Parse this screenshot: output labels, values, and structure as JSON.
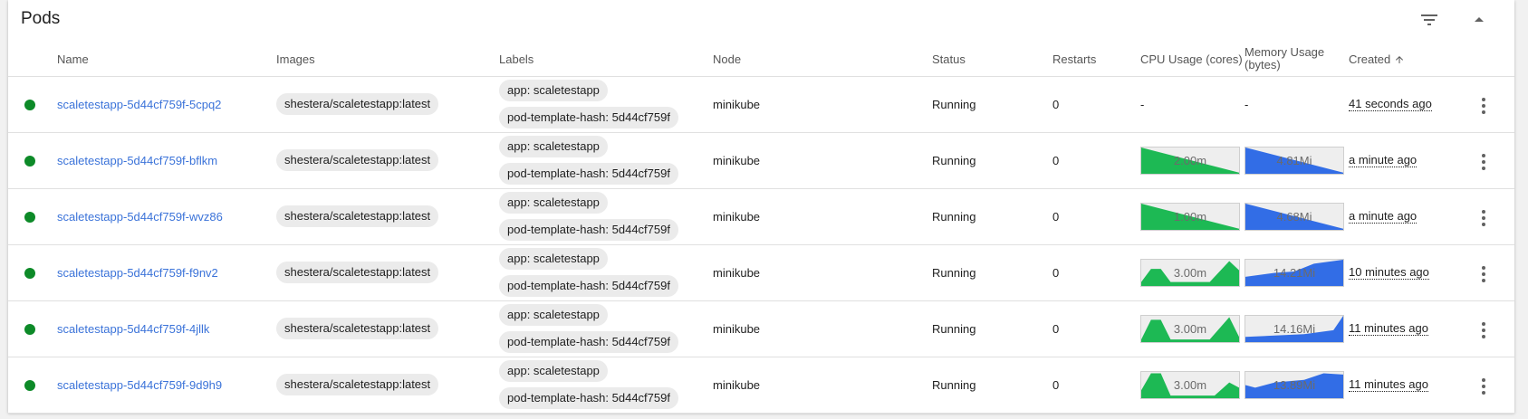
{
  "card": {
    "title": "Pods"
  },
  "icons": {
    "filter": "filter-list-icon",
    "collapse": "expand-less-icon",
    "row_menu": "more-vert-icon",
    "sort": "arrow-upward-icon"
  },
  "columns": {
    "name": "Name",
    "images": "Images",
    "labels": "Labels",
    "node": "Node",
    "status": "Status",
    "restarts": "Restarts",
    "cpu": "CPU Usage (cores)",
    "memory_line1": "Memory Usage",
    "memory_line2": "(bytes)",
    "created": "Created"
  },
  "colors": {
    "status_ok": "#0d8a28",
    "link": "#3b73d9",
    "cpu_spark": "#1db954",
    "mem_spark": "#326de6"
  },
  "rows": [
    {
      "name": "scaletestapp-5d44cf759f-5cpq2",
      "image": "shestera/scaletestapp:latest",
      "label_app": "app: scaletestapp",
      "label_hash": "pod-template-hash: 5d44cf759f",
      "node": "minikube",
      "status": "Running",
      "restarts": "0",
      "cpu_text": "-",
      "mem_text": "-",
      "created": "41 seconds ago"
    },
    {
      "name": "scaletestapp-5d44cf759f-bflkm",
      "image": "shestera/scaletestapp:latest",
      "label_app": "app: scaletestapp",
      "label_hash": "pod-template-hash: 5d44cf759f",
      "node": "minikube",
      "status": "Running",
      "restarts": "0",
      "cpu_text": "2.00m",
      "mem_text": "4.81Mi",
      "created": "a minute ago"
    },
    {
      "name": "scaletestapp-5d44cf759f-wvz86",
      "image": "shestera/scaletestapp:latest",
      "label_app": "app: scaletestapp",
      "label_hash": "pod-template-hash: 5d44cf759f",
      "node": "minikube",
      "status": "Running",
      "restarts": "0",
      "cpu_text": "1.00m",
      "mem_text": "4.68Mi",
      "created": "a minute ago"
    },
    {
      "name": "scaletestapp-5d44cf759f-f9nv2",
      "image": "shestera/scaletestapp:latest",
      "label_app": "app: scaletestapp",
      "label_hash": "pod-template-hash: 5d44cf759f",
      "node": "minikube",
      "status": "Running",
      "restarts": "0",
      "cpu_text": "3.00m",
      "mem_text": "14.21Mi",
      "created": "10 minutes ago"
    },
    {
      "name": "scaletestapp-5d44cf759f-4jllk",
      "image": "shestera/scaletestapp:latest",
      "label_app": "app: scaletestapp",
      "label_hash": "pod-template-hash: 5d44cf759f",
      "node": "minikube",
      "status": "Running",
      "restarts": "0",
      "cpu_text": "3.00m",
      "mem_text": "14.16Mi",
      "created": "11 minutes ago"
    },
    {
      "name": "scaletestapp-5d44cf759f-9d9h9",
      "image": "shestera/scaletestapp:latest",
      "label_app": "app: scaletestapp",
      "label_hash": "pod-template-hash: 5d44cf759f",
      "node": "minikube",
      "status": "Running",
      "restarts": "0",
      "cpu_text": "3.00m",
      "mem_text": "13.89Mi",
      "created": "11 minutes ago"
    }
  ]
}
